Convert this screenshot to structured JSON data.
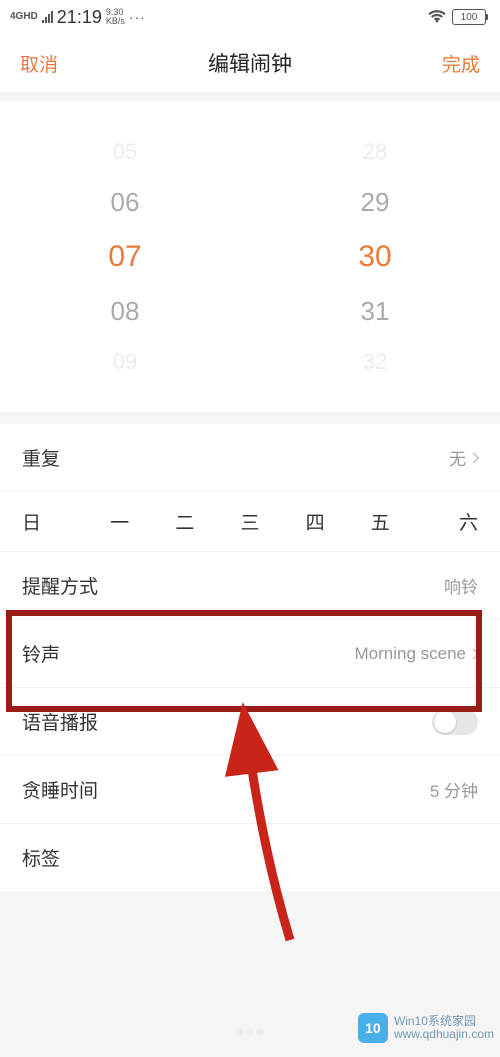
{
  "status": {
    "net": "4GHD",
    "time": "21:19",
    "speed_top": "9.30",
    "speed_unit": "KB/s",
    "dots": "···",
    "battery": "100"
  },
  "header": {
    "cancel": "取消",
    "title": "编辑闹钟",
    "done": "完成"
  },
  "picker": {
    "hours": [
      "05",
      "06",
      "07",
      "08",
      "09"
    ],
    "minutes": [
      "28",
      "29",
      "30",
      "31",
      "32"
    ]
  },
  "settings": {
    "repeat_label": "重复",
    "repeat_value": "无",
    "weekdays": [
      "日",
      "一",
      "二",
      "三",
      "四",
      "五",
      "六"
    ],
    "remind_label": "提醒方式",
    "remind_value": "响铃",
    "ringtone_label": "铃声",
    "ringtone_value": "Morning scene",
    "voice_label": "语音播报",
    "voice_on": false,
    "snooze_label": "贪睡时间",
    "snooze_value": "5 分钟",
    "tag_label": "标签"
  },
  "watermark": {
    "brand": "Win10系统家园",
    "url": "www.qdhuajin.com"
  }
}
